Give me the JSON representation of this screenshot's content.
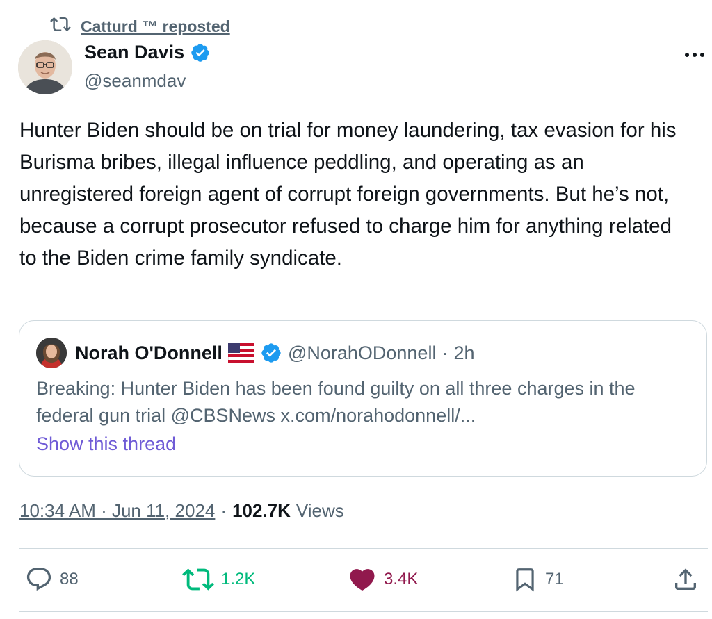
{
  "repost": {
    "label": "Catturd ™ reposted",
    "icon": "repost-icon"
  },
  "author": {
    "name": "Sean Davis",
    "handle": "@seanmdav",
    "verified_icon": "verified-badge-icon"
  },
  "more_icon": "more-options-icon",
  "post": {
    "text": "Hunter Biden should be on trial for money laundering, tax evasion for his Burisma bribes, illegal influence peddling, and operating as an unregistered foreign agent of corrupt foreign governments. But he’s not, because a corrupt prosecutor refused to charge him for anything related to the Biden crime family syndicate."
  },
  "quote": {
    "name": "Norah O'Donnell",
    "flag_icon": "us-flag-icon",
    "handle": "@NorahODonnell",
    "separator": "·",
    "age": "2h",
    "text": "Breaking: Hunter Biden has been found guilty on all three charges in the federal gun trial @CBSNews x.com/norahodonnell/...",
    "show_thread": "Show this thread"
  },
  "meta": {
    "time": "10:34 AM · Jun 11, 2024",
    "separator": "·",
    "views_count": "102.7K",
    "views_label": "Views"
  },
  "actions": {
    "replies": "88",
    "reposts": "1.2K",
    "likes": "3.4K",
    "bookmarks": "71"
  },
  "colors": {
    "secondary_text": "#536471",
    "repost_green": "#00ba7c",
    "like_pink": "#91194d",
    "verified_blue": "#1d9bf0",
    "link_purple": "#6f5bd6",
    "border": "#cfd9de"
  }
}
